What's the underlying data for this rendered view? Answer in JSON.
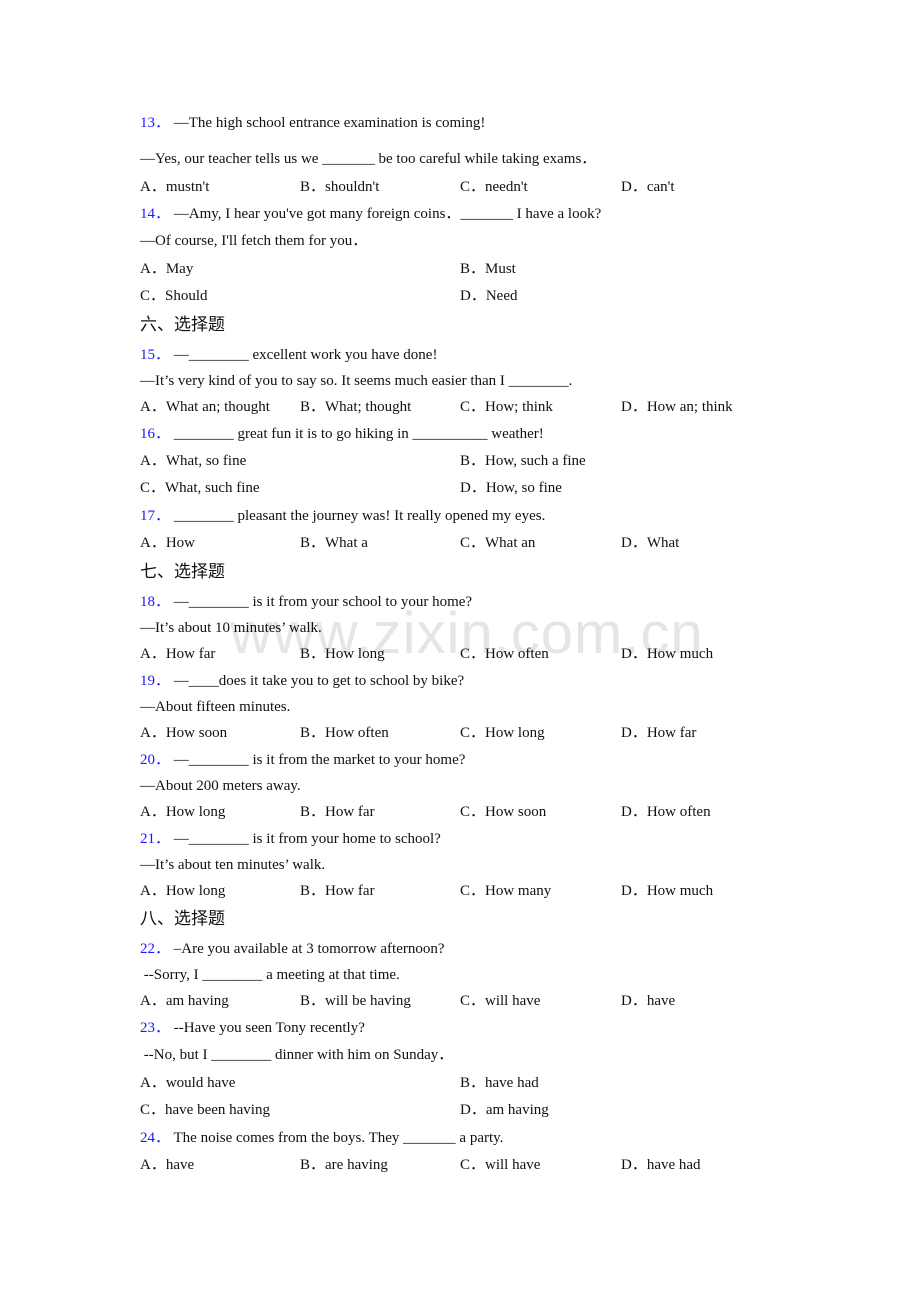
{
  "watermark": "www.zixin.com.cn",
  "sections": {
    "six": "六、选择题",
    "seven": "七、选择题",
    "eight": "八、选择题"
  },
  "questions": [
    {
      "num": "13．",
      "lines": [
        "—The high school entrance examination is coming!",
        "—Yes, our teacher tells us we _______ be too careful while taking exams．"
      ],
      "options": [
        "A．mustn't",
        "B．shouldn't",
        "C．needn't",
        "D．can't"
      ]
    },
    {
      "num": "14．",
      "lines": [
        "—Amy, I hear you've got many foreign coins．_______ I have a look?",
        "—Of course, I'll fetch them for you．"
      ],
      "options": [
        "A．May",
        "B．Must",
        "C．Should",
        "D．Need"
      ]
    },
    {
      "num": "15．",
      "lines": [
        "—________ excellent work you have done!",
        "—It’s very kind of you to say so. It seems much easier than I ________."
      ],
      "options": [
        "A．What an; thought",
        "B．What; thought",
        "C．How; think",
        "D．How an; think"
      ]
    },
    {
      "num": "16．",
      "lines": [
        "________ great fun it is to go hiking in __________ weather!"
      ],
      "options": [
        "A．What, so fine",
        "B．How, such a fine",
        "C．What, such fine",
        "D．How, so fine"
      ]
    },
    {
      "num": "17．",
      "lines": [
        "________ pleasant the journey was! It really opened my eyes."
      ],
      "options": [
        "A．How",
        "B．What a",
        "C．What an",
        "D．What"
      ]
    },
    {
      "num": "18．",
      "lines": [
        "—________ is it from your school to your home?",
        "—It’s about 10 minutes’ walk."
      ],
      "options": [
        "A．How far",
        "B．How long",
        "C．How often",
        "D．How much"
      ]
    },
    {
      "num": "19．",
      "lines": [
        "—____does it take you to get to school by bike?",
        "—About fifteen minutes."
      ],
      "options": [
        "A．How soon",
        "B．How often",
        "C．How long",
        "D．How far"
      ]
    },
    {
      "num": "20．",
      "lines": [
        "—________ is it from the market to your home?",
        "—About 200 meters away."
      ],
      "options": [
        "A．How long",
        "B．How far",
        "C．How soon",
        "D．How often"
      ]
    },
    {
      "num": "21．",
      "lines": [
        "—________ is it from your home to school?",
        "—It’s about ten minutes’ walk."
      ],
      "options": [
        "A．How long",
        "B．How far",
        "C．How many",
        "D．How much"
      ]
    },
    {
      "num": "22．",
      "lines": [
        "–Are you available at 3 tomorrow afternoon?",
        " --Sorry, I ________ a meeting at that time."
      ],
      "options": [
        "A．am having",
        "B．will be having",
        "C．will have",
        "D．have"
      ]
    },
    {
      "num": "23．",
      "lines": [
        "--Have you seen Tony recently?",
        " --No, but I ________ dinner with him on Sunday．"
      ],
      "options": [
        "A．would have",
        "B．have had",
        "C．have been having",
        "D．am having"
      ]
    },
    {
      "num": "24．",
      "lines": [
        "The noise comes from the boys. They _______ a party."
      ],
      "options": [
        "A．have",
        "B．are having",
        "C．will have",
        "D．have had"
      ]
    }
  ]
}
